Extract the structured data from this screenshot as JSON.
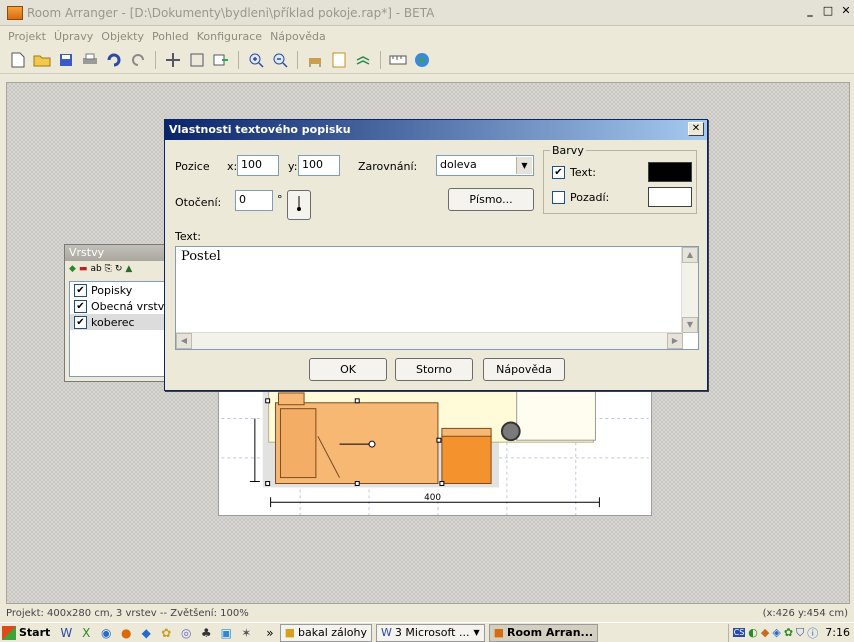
{
  "window": {
    "title": "Room Arranger - [D:\\Dokumenty\\bydleni\\příklad pokoje.rap*] - BETA"
  },
  "menu": [
    "Projekt",
    "Úpravy",
    "Objekty",
    "Pohled",
    "Konfigurace",
    "Nápověda"
  ],
  "toolbar": [
    "new-file-icon",
    "open-folder-icon",
    "save-icon",
    "print-icon",
    "undo-icon",
    "redo-icon",
    "sep",
    "move-icon",
    "fit-icon",
    "export-icon",
    "sep",
    "zoom-in-icon",
    "zoom-out-icon",
    "sep",
    "furniture-icon",
    "page-icon",
    "layers-icon",
    "sep",
    "ruler-icon",
    "globe-icon"
  ],
  "layers_panel": {
    "title": "Vrstvy",
    "items": [
      {
        "label": "Popisky",
        "checked": true
      },
      {
        "label": "Obecná vrstva",
        "checked": true
      },
      {
        "label": "koberec",
        "checked": true
      }
    ]
  },
  "dialog": {
    "title": "Vlastnosti textového popisku",
    "pozice_label": "Pozice",
    "x_label": "x:",
    "x_value": "100",
    "y_label": "y:",
    "y_value": "100",
    "zarovnani_label": "Zarovnání:",
    "zarovnani_value": "doleva",
    "otoceni_label": "Otočení:",
    "otoceni_value": "0",
    "degree": "°",
    "pismo_button": "Písmo...",
    "barvy_label": "Barvy",
    "text_color_label": "Text:",
    "text_color": "#000000",
    "text_color_checked": true,
    "pozadi_label": "Pozadí:",
    "pozadi_color": "#ffffff",
    "pozadi_checked": false,
    "text_label": "Text:",
    "text_value": "Postel",
    "ok": "OK",
    "storno": "Storno",
    "napoveda": "Nápověda"
  },
  "drawing": {
    "dimension": "400"
  },
  "status": {
    "left": "Projekt: 400x280 cm, 3 vrstev -- Zvětšení: 100%",
    "right": "(x:426 y:454 cm)"
  },
  "taskbar": {
    "start": "Start",
    "more": "»",
    "tasks": [
      {
        "label": "bakal zálohy",
        "active": false
      },
      {
        "label": "3 Microsoft ...",
        "active": false
      },
      {
        "label": "Room Arran...",
        "active": true
      }
    ],
    "clock": "7:16"
  }
}
